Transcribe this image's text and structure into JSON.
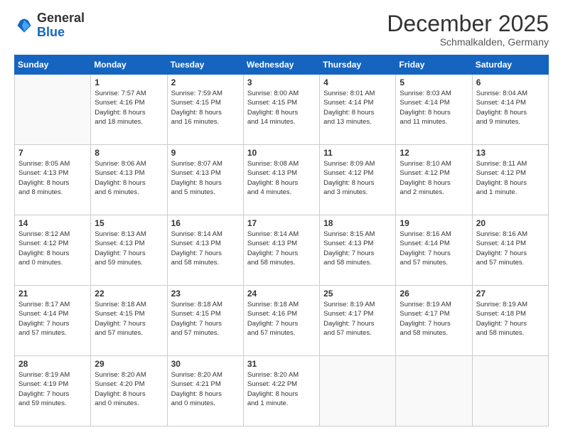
{
  "header": {
    "logo_general": "General",
    "logo_blue": "Blue",
    "month": "December 2025",
    "location": "Schmalkalden, Germany"
  },
  "weekdays": [
    "Sunday",
    "Monday",
    "Tuesday",
    "Wednesday",
    "Thursday",
    "Friday",
    "Saturday"
  ],
  "weeks": [
    [
      {
        "day": "",
        "info": ""
      },
      {
        "day": "1",
        "info": "Sunrise: 7:57 AM\nSunset: 4:16 PM\nDaylight: 8 hours\nand 18 minutes."
      },
      {
        "day": "2",
        "info": "Sunrise: 7:59 AM\nSunset: 4:15 PM\nDaylight: 8 hours\nand 16 minutes."
      },
      {
        "day": "3",
        "info": "Sunrise: 8:00 AM\nSunset: 4:15 PM\nDaylight: 8 hours\nand 14 minutes."
      },
      {
        "day": "4",
        "info": "Sunrise: 8:01 AM\nSunset: 4:14 PM\nDaylight: 8 hours\nand 13 minutes."
      },
      {
        "day": "5",
        "info": "Sunrise: 8:03 AM\nSunset: 4:14 PM\nDaylight: 8 hours\nand 11 minutes."
      },
      {
        "day": "6",
        "info": "Sunrise: 8:04 AM\nSunset: 4:14 PM\nDaylight: 8 hours\nand 9 minutes."
      }
    ],
    [
      {
        "day": "7",
        "info": "Sunrise: 8:05 AM\nSunset: 4:13 PM\nDaylight: 8 hours\nand 8 minutes."
      },
      {
        "day": "8",
        "info": "Sunrise: 8:06 AM\nSunset: 4:13 PM\nDaylight: 8 hours\nand 6 minutes."
      },
      {
        "day": "9",
        "info": "Sunrise: 8:07 AM\nSunset: 4:13 PM\nDaylight: 8 hours\nand 5 minutes."
      },
      {
        "day": "10",
        "info": "Sunrise: 8:08 AM\nSunset: 4:13 PM\nDaylight: 8 hours\nand 4 minutes."
      },
      {
        "day": "11",
        "info": "Sunrise: 8:09 AM\nSunset: 4:12 PM\nDaylight: 8 hours\nand 3 minutes."
      },
      {
        "day": "12",
        "info": "Sunrise: 8:10 AM\nSunset: 4:12 PM\nDaylight: 8 hours\nand 2 minutes."
      },
      {
        "day": "13",
        "info": "Sunrise: 8:11 AM\nSunset: 4:12 PM\nDaylight: 8 hours\nand 1 minute."
      }
    ],
    [
      {
        "day": "14",
        "info": "Sunrise: 8:12 AM\nSunset: 4:12 PM\nDaylight: 8 hours\nand 0 minutes."
      },
      {
        "day": "15",
        "info": "Sunrise: 8:13 AM\nSunset: 4:13 PM\nDaylight: 7 hours\nand 59 minutes."
      },
      {
        "day": "16",
        "info": "Sunrise: 8:14 AM\nSunset: 4:13 PM\nDaylight: 7 hours\nand 58 minutes."
      },
      {
        "day": "17",
        "info": "Sunrise: 8:14 AM\nSunset: 4:13 PM\nDaylight: 7 hours\nand 58 minutes."
      },
      {
        "day": "18",
        "info": "Sunrise: 8:15 AM\nSunset: 4:13 PM\nDaylight: 7 hours\nand 58 minutes."
      },
      {
        "day": "19",
        "info": "Sunrise: 8:16 AM\nSunset: 4:14 PM\nDaylight: 7 hours\nand 57 minutes."
      },
      {
        "day": "20",
        "info": "Sunrise: 8:16 AM\nSunset: 4:14 PM\nDaylight: 7 hours\nand 57 minutes."
      }
    ],
    [
      {
        "day": "21",
        "info": "Sunrise: 8:17 AM\nSunset: 4:14 PM\nDaylight: 7 hours\nand 57 minutes."
      },
      {
        "day": "22",
        "info": "Sunrise: 8:18 AM\nSunset: 4:15 PM\nDaylight: 7 hours\nand 57 minutes."
      },
      {
        "day": "23",
        "info": "Sunrise: 8:18 AM\nSunset: 4:15 PM\nDaylight: 7 hours\nand 57 minutes."
      },
      {
        "day": "24",
        "info": "Sunrise: 8:18 AM\nSunset: 4:16 PM\nDaylight: 7 hours\nand 57 minutes."
      },
      {
        "day": "25",
        "info": "Sunrise: 8:19 AM\nSunset: 4:17 PM\nDaylight: 7 hours\nand 57 minutes."
      },
      {
        "day": "26",
        "info": "Sunrise: 8:19 AM\nSunset: 4:17 PM\nDaylight: 7 hours\nand 58 minutes."
      },
      {
        "day": "27",
        "info": "Sunrise: 8:19 AM\nSunset: 4:18 PM\nDaylight: 7 hours\nand 58 minutes."
      }
    ],
    [
      {
        "day": "28",
        "info": "Sunrise: 8:19 AM\nSunset: 4:19 PM\nDaylight: 7 hours\nand 59 minutes."
      },
      {
        "day": "29",
        "info": "Sunrise: 8:20 AM\nSunset: 4:20 PM\nDaylight: 8 hours\nand 0 minutes."
      },
      {
        "day": "30",
        "info": "Sunrise: 8:20 AM\nSunset: 4:21 PM\nDaylight: 8 hours\nand 0 minutes."
      },
      {
        "day": "31",
        "info": "Sunrise: 8:20 AM\nSunset: 4:22 PM\nDaylight: 8 hours\nand 1 minute."
      },
      {
        "day": "",
        "info": ""
      },
      {
        "day": "",
        "info": ""
      },
      {
        "day": "",
        "info": ""
      }
    ]
  ]
}
